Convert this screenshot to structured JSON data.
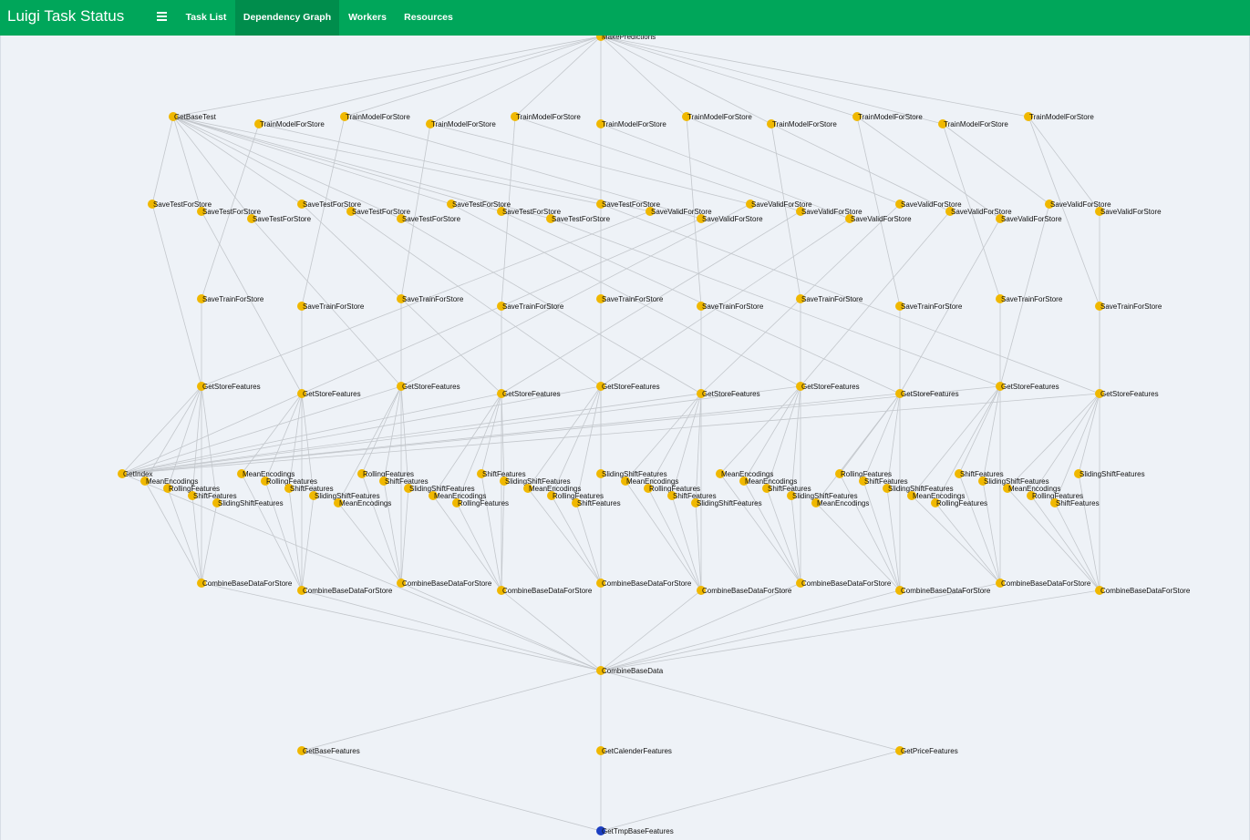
{
  "navbar": {
    "title": "Luigi Task Status",
    "tabs": [
      {
        "label": "Task List"
      },
      {
        "label": "Dependency Graph"
      },
      {
        "label": "Workers"
      },
      {
        "label": "Resources"
      }
    ]
  },
  "graph": {
    "colors": {
      "pending": "#f0b800",
      "root": "#1c3fc2",
      "edge": "#c3c7cc"
    },
    "nodes": [
      {
        "label": "MakePredictions",
        "status": "pending"
      },
      {
        "label": "GetBaseTest",
        "status": "pending"
      },
      {
        "label": "TrainModelForStore",
        "status": "pending"
      },
      {
        "label": "TrainModelForStore",
        "status": "pending"
      },
      {
        "label": "TrainModelForStore",
        "status": "pending"
      },
      {
        "label": "TrainModelForStore",
        "status": "pending"
      },
      {
        "label": "TrainModelForStore",
        "status": "pending"
      },
      {
        "label": "TrainModelForStore",
        "status": "pending"
      },
      {
        "label": "TrainModelForStore",
        "status": "pending"
      },
      {
        "label": "TrainModelForStore",
        "status": "pending"
      },
      {
        "label": "TrainModelForStore",
        "status": "pending"
      },
      {
        "label": "TrainModelForStore",
        "status": "pending"
      },
      {
        "label": "SaveTestForStore",
        "status": "pending"
      },
      {
        "label": "SaveTestForStore",
        "status": "pending"
      },
      {
        "label": "SaveTestForStore",
        "status": "pending"
      },
      {
        "label": "SaveTestForStore",
        "status": "pending"
      },
      {
        "label": "SaveTestForStore",
        "status": "pending"
      },
      {
        "label": "SaveTestForStore",
        "status": "pending"
      },
      {
        "label": "SaveTestForStore",
        "status": "pending"
      },
      {
        "label": "SaveTestForStore",
        "status": "pending"
      },
      {
        "label": "SaveTestForStore",
        "status": "pending"
      },
      {
        "label": "SaveTestForStore",
        "status": "pending"
      },
      {
        "label": "SaveValidForStore",
        "status": "pending"
      },
      {
        "label": "SaveValidForStore",
        "status": "pending"
      },
      {
        "label": "SaveValidForStore",
        "status": "pending"
      },
      {
        "label": "SaveValidForStore",
        "status": "pending"
      },
      {
        "label": "SaveValidForStore",
        "status": "pending"
      },
      {
        "label": "SaveValidForStore",
        "status": "pending"
      },
      {
        "label": "SaveValidForStore",
        "status": "pending"
      },
      {
        "label": "SaveValidForStore",
        "status": "pending"
      },
      {
        "label": "SaveValidForStore",
        "status": "pending"
      },
      {
        "label": "SaveValidForStore",
        "status": "pending"
      },
      {
        "label": "SaveTrainForStore",
        "status": "pending"
      },
      {
        "label": "SaveTrainForStore",
        "status": "pending"
      },
      {
        "label": "SaveTrainForStore",
        "status": "pending"
      },
      {
        "label": "SaveTrainForStore",
        "status": "pending"
      },
      {
        "label": "SaveTrainForStore",
        "status": "pending"
      },
      {
        "label": "SaveTrainForStore",
        "status": "pending"
      },
      {
        "label": "SaveTrainForStore",
        "status": "pending"
      },
      {
        "label": "SaveTrainForStore",
        "status": "pending"
      },
      {
        "label": "SaveTrainForStore",
        "status": "pending"
      },
      {
        "label": "SaveTrainForStore",
        "status": "pending"
      },
      {
        "label": "GetStoreFeatures",
        "status": "pending"
      },
      {
        "label": "GetStoreFeatures",
        "status": "pending"
      },
      {
        "label": "GetStoreFeatures",
        "status": "pending"
      },
      {
        "label": "GetStoreFeatures",
        "status": "pending"
      },
      {
        "label": "GetStoreFeatures",
        "status": "pending"
      },
      {
        "label": "GetStoreFeatures",
        "status": "pending"
      },
      {
        "label": "GetStoreFeatures",
        "status": "pending"
      },
      {
        "label": "GetStoreFeatures",
        "status": "pending"
      },
      {
        "label": "GetStoreFeatures",
        "status": "pending"
      },
      {
        "label": "GetStoreFeatures",
        "status": "pending"
      },
      {
        "label": "GetIndex",
        "status": "pending"
      },
      {
        "label": "MeanEncodings",
        "status": "pending"
      },
      {
        "label": "RollingFeatures",
        "status": "pending"
      },
      {
        "label": "ShiftFeatures",
        "status": "pending"
      },
      {
        "label": "SlidingShiftFeatures",
        "status": "pending"
      },
      {
        "label": "MeanEncodings",
        "status": "pending"
      },
      {
        "label": "RollingFeatures",
        "status": "pending"
      },
      {
        "label": "ShiftFeatures",
        "status": "pending"
      },
      {
        "label": "SlidingShiftFeatures",
        "status": "pending"
      },
      {
        "label": "MeanEncodings",
        "status": "pending"
      },
      {
        "label": "RollingFeatures",
        "status": "pending"
      },
      {
        "label": "ShiftFeatures",
        "status": "pending"
      },
      {
        "label": "SlidingShiftFeatures",
        "status": "pending"
      },
      {
        "label": "MeanEncodings",
        "status": "pending"
      },
      {
        "label": "RollingFeatures",
        "status": "pending"
      },
      {
        "label": "ShiftFeatures",
        "status": "pending"
      },
      {
        "label": "SlidingShiftFeatures",
        "status": "pending"
      },
      {
        "label": "MeanEncodings",
        "status": "pending"
      },
      {
        "label": "RollingFeatures",
        "status": "pending"
      },
      {
        "label": "ShiftFeatures",
        "status": "pending"
      },
      {
        "label": "SlidingShiftFeatures",
        "status": "pending"
      },
      {
        "label": "MeanEncodings",
        "status": "pending"
      },
      {
        "label": "RollingFeatures",
        "status": "pending"
      },
      {
        "label": "ShiftFeatures",
        "status": "pending"
      },
      {
        "label": "SlidingShiftFeatures",
        "status": "pending"
      },
      {
        "label": "MeanEncodings",
        "status": "pending"
      },
      {
        "label": "MeanEncodings",
        "status": "pending"
      },
      {
        "label": "ShiftFeatures",
        "status": "pending"
      },
      {
        "label": "SlidingShiftFeatures",
        "status": "pending"
      },
      {
        "label": "MeanEncodings",
        "status": "pending"
      },
      {
        "label": "RollingFeatures",
        "status": "pending"
      },
      {
        "label": "ShiftFeatures",
        "status": "pending"
      },
      {
        "label": "SlidingShiftFeatures",
        "status": "pending"
      },
      {
        "label": "MeanEncodings",
        "status": "pending"
      },
      {
        "label": "RollingFeatures",
        "status": "pending"
      },
      {
        "label": "ShiftFeatures",
        "status": "pending"
      },
      {
        "label": "SlidingShiftFeatures",
        "status": "pending"
      },
      {
        "label": "MeanEncodings",
        "status": "pending"
      },
      {
        "label": "RollingFeatures",
        "status": "pending"
      },
      {
        "label": "ShiftFeatures",
        "status": "pending"
      },
      {
        "label": "SlidingShiftFeatures",
        "status": "pending"
      },
      {
        "label": "CombineBaseDataForStore",
        "status": "pending"
      },
      {
        "label": "CombineBaseDataForStore",
        "status": "pending"
      },
      {
        "label": "CombineBaseDataForStore",
        "status": "pending"
      },
      {
        "label": "CombineBaseDataForStore",
        "status": "pending"
      },
      {
        "label": "CombineBaseDataForStore",
        "status": "pending"
      },
      {
        "label": "CombineBaseDataForStore",
        "status": "pending"
      },
      {
        "label": "CombineBaseDataForStore",
        "status": "pending"
      },
      {
        "label": "CombineBaseDataForStore",
        "status": "pending"
      },
      {
        "label": "CombineBaseDataForStore",
        "status": "pending"
      },
      {
        "label": "CombineBaseDataForStore",
        "status": "pending"
      },
      {
        "label": "CombineBaseData",
        "status": "pending"
      },
      {
        "label": "GetBaseFeatures",
        "status": "pending"
      },
      {
        "label": "GetCalenderFeatures",
        "status": "pending"
      },
      {
        "label": "GetPriceFeatures",
        "status": "pending"
      },
      {
        "label": "GetTmpBaseFeatures",
        "status": "root"
      }
    ]
  }
}
